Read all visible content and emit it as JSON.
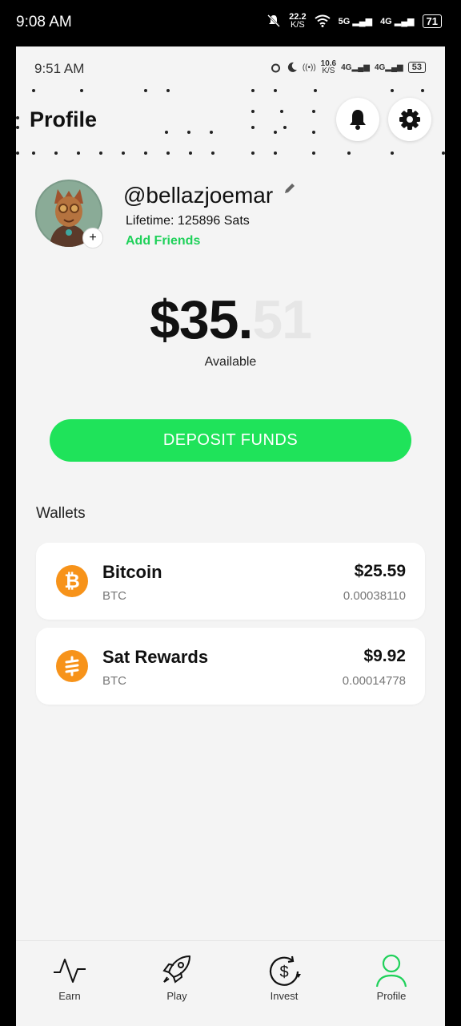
{
  "outer_status": {
    "time": "9:08 AM",
    "speed": "22.2",
    "speed_unit": "K/S",
    "net1": "5G",
    "net2": "4G",
    "battery": "71"
  },
  "inner_status": {
    "time": "9:51 AM",
    "speed": "10.6",
    "speed_unit": "K/S",
    "net1": "4G",
    "net2": "4G",
    "battery": "53"
  },
  "header": {
    "title": "Profile"
  },
  "profile": {
    "username": "@bellazjoemar",
    "lifetime": "Lifetime: 125896 Sats",
    "add_friends": "Add Friends",
    "avatar_plus": "+"
  },
  "balance": {
    "whole": "$35.",
    "cents": "51",
    "label": "Available"
  },
  "deposit_label": "DEPOSIT FUNDS",
  "wallets": {
    "title": "Wallets",
    "items": [
      {
        "name": "Bitcoin",
        "ticker": "BTC",
        "usd": "$25.59",
        "btc": "0.00038110",
        "icon": "bitcoin-icon"
      },
      {
        "name": "Sat Rewards",
        "ticker": "BTC",
        "usd": "$9.92",
        "btc": "0.00014778",
        "icon": "sats-icon"
      }
    ]
  },
  "colors": {
    "accent_green": "#1fe35a",
    "link_green": "#1fd15a",
    "coin_orange": "#f7931a",
    "background": "#f4f4f4"
  },
  "nav": {
    "items": [
      {
        "label": "Earn",
        "icon": "activity-icon"
      },
      {
        "label": "Play",
        "icon": "rocket-icon"
      },
      {
        "label": "Invest",
        "icon": "dollar-cycle-icon"
      },
      {
        "label": "Profile",
        "icon": "user-icon",
        "active": true
      }
    ]
  }
}
